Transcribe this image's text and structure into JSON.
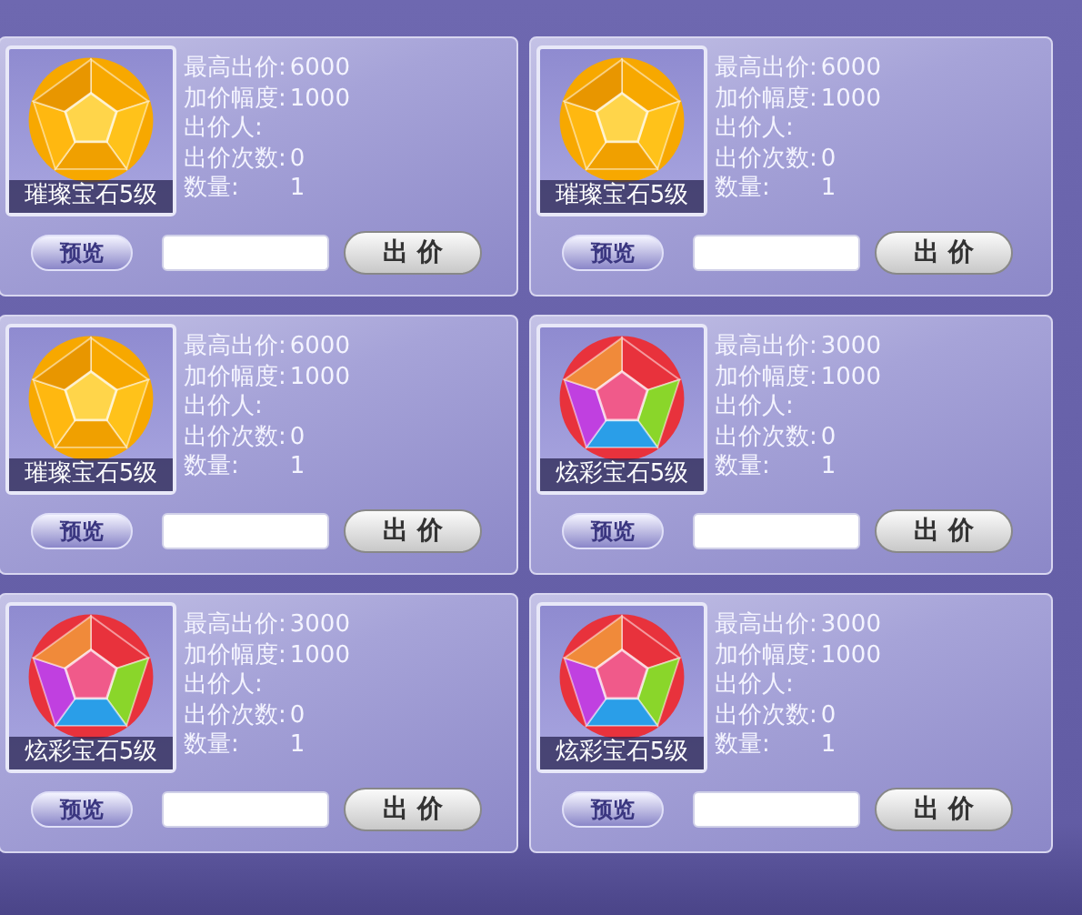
{
  "cards": [
    {
      "kind": "amber",
      "name": "璀璨宝石5级",
      "fields": [
        {
          "label": "最高出价:",
          "value": "6000"
        },
        {
          "label": "加价幅度:",
          "value": "1000"
        },
        {
          "label": "出价人:"
        },
        {
          "label": "出价次数:",
          "value": "0"
        },
        {
          "label": "数量:",
          "value": "1"
        }
      ],
      "preview": "预览",
      "bid": "出 价"
    },
    {
      "kind": "amber",
      "name": "璀璨宝石5级",
      "fields": [
        {
          "label": "最高出价:",
          "value": "6000"
        },
        {
          "label": "加价幅度:",
          "value": "1000"
        },
        {
          "label": "出价人:"
        },
        {
          "label": "出价次数:",
          "value": "0"
        },
        {
          "label": "数量:",
          "value": "1"
        }
      ],
      "preview": "预览",
      "bid": "出 价"
    },
    {
      "kind": "amber",
      "name": "璀璨宝石5级",
      "fields": [
        {
          "label": "最高出价:",
          "value": "6000"
        },
        {
          "label": "加价幅度:",
          "value": "1000"
        },
        {
          "label": "出价人:"
        },
        {
          "label": "出价次数:",
          "value": "0"
        },
        {
          "label": "数量:",
          "value": "1"
        }
      ],
      "preview": "预览",
      "bid": "出 价"
    },
    {
      "kind": "multicolor",
      "name": "炫彩宝石5级",
      "fields": [
        {
          "label": "最高出价:",
          "value": "3000"
        },
        {
          "label": "加价幅度:",
          "value": "1000"
        },
        {
          "label": "出价人:"
        },
        {
          "label": "出价次数:",
          "value": "0"
        },
        {
          "label": "数量:",
          "value": "1"
        }
      ],
      "preview": "预览",
      "bid": "出 价"
    },
    {
      "kind": "multicolor",
      "name": "炫彩宝石5级",
      "fields": [
        {
          "label": "最高出价:",
          "value": "3000"
        },
        {
          "label": "加价幅度:",
          "value": "1000"
        },
        {
          "label": "出价人:"
        },
        {
          "label": "出价次数:",
          "value": "0"
        },
        {
          "label": "数量:",
          "value": "1"
        }
      ],
      "preview": "预览",
      "bid": "出 价"
    },
    {
      "kind": "multicolor",
      "name": "炫彩宝石5级",
      "fields": [
        {
          "label": "最高出价:",
          "value": "3000"
        },
        {
          "label": "加价幅度:",
          "value": "1000"
        },
        {
          "label": "出价人:"
        },
        {
          "label": "出价次数:",
          "value": "0"
        },
        {
          "label": "数量:",
          "value": "1"
        }
      ],
      "preview": "预览",
      "bid": "出 价"
    }
  ]
}
